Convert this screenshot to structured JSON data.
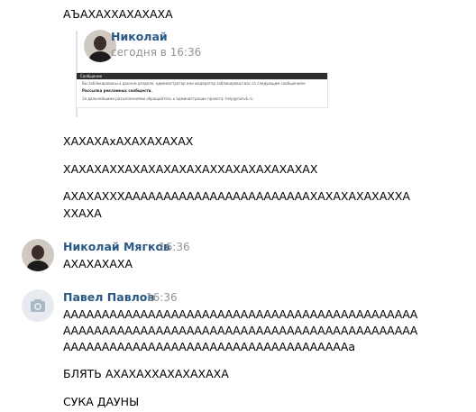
{
  "messages": {
    "top_text": "АЪАХАХХАХАХАХА",
    "forwarded": {
      "author": "Николай",
      "time": "сегодня в 16:36",
      "thumbnail": {
        "header": "Сообщение",
        "line1": "Вы заблокированы в данном разделе, администратор или модератор заблокировал вас со следующим сообщением:",
        "line2": "Рассылка рекламных сообществ.",
        "line3": "За дальнейшими разъяснениями обращайтесь к администрации проекта: help@rainvk.ru"
      }
    },
    "group1": [
      "ХАХАХАхАХАХАХАХАХ",
      "ХАХАХАХХАХАХАХАХАХАХХАХАХАХАХАХАХ",
      "АХАХАХХХААААААААААААААААААААААААХАХАХАХАХАХХА",
      "ХХАХА"
    ],
    "msg2": {
      "author": "Николай Мягков",
      "time": "16:36",
      "text": "АХАХАХАХА"
    },
    "msg3": {
      "author": "Павел Павлов",
      "time": "16:36",
      "lines": [
        "АААААААААААААААААААААААААААААААААААААААААААААА",
        "АААААААААААААААААААААААААААААААААААААААААААААА",
        "АААААААААААААААААААААААААААААААААААААа",
        "БЛЯТЬ АХАХАХХАХАХАХАХА",
        "СУКА ДАУНЫ"
      ]
    }
  },
  "icons": {
    "avatar_placeholder": "camera-icon"
  },
  "colors": {
    "name": "#2a5885",
    "time": "#939393",
    "placeholder_bg": "#e7ebf0",
    "placeholder_icon": "#aab7c6"
  }
}
